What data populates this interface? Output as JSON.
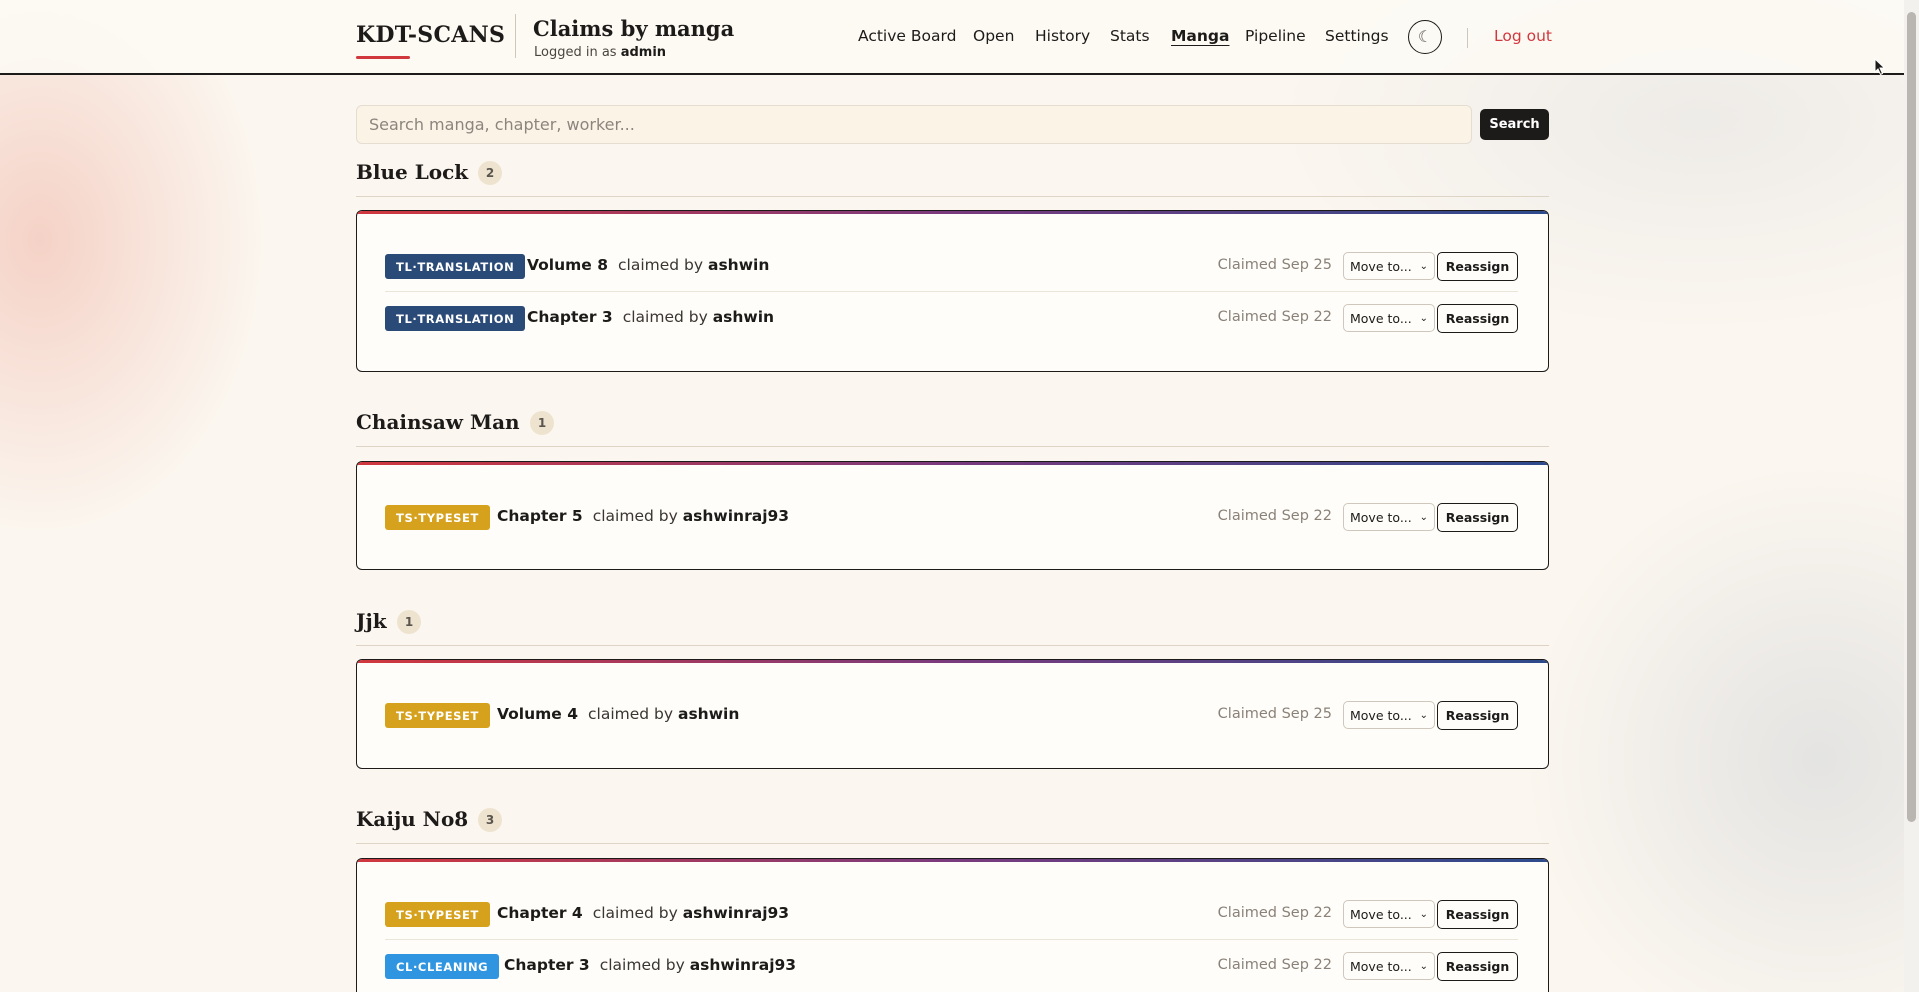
{
  "brand": "KDT-SCANS",
  "header": {
    "title": "Claims by manga",
    "logged_in_prefix": "Logged in as",
    "user": "admin"
  },
  "nav": [
    {
      "label": "Active Board",
      "active": false
    },
    {
      "label": "Open",
      "active": false
    },
    {
      "label": "History",
      "active": false
    },
    {
      "label": "Stats",
      "active": false
    },
    {
      "label": "Manga",
      "active": true
    },
    {
      "label": "Pipeline",
      "active": false
    },
    {
      "label": "Settings",
      "active": false
    }
  ],
  "theme_toggle": {
    "icon": "moon-icon",
    "glyph": "☾"
  },
  "logout_label": "Log out",
  "search": {
    "placeholder": "Search manga, chapter, worker...",
    "value": "",
    "button_label": "Search"
  },
  "labels": {
    "claimed_by": "claimed by",
    "move_to": "Move to...",
    "reassign": "Reassign"
  },
  "colors": {
    "accent_red": "#d1383e",
    "tl_translation": "#2a4a78",
    "ts_typeset": "#d6a21d",
    "cl_cleaning": "#2f95e0"
  },
  "groups": [
    {
      "title": "Blue Lock",
      "count": "2",
      "claims": [
        {
          "stage": "TL·TRANSLATION",
          "stage_key": "tl_translation",
          "chapter": "Volume 8",
          "worker": "ashwin",
          "claimed": "Claimed Sep 25"
        },
        {
          "stage": "TL·TRANSLATION",
          "stage_key": "tl_translation",
          "chapter": "Chapter 3",
          "worker": "ashwin",
          "claimed": "Claimed Sep 22"
        }
      ]
    },
    {
      "title": "Chainsaw Man",
      "count": "1",
      "claims": [
        {
          "stage": "TS·TYPESET",
          "stage_key": "ts_typeset",
          "chapter": "Chapter 5",
          "worker": "ashwinraj93",
          "claimed": "Claimed Sep 22"
        }
      ]
    },
    {
      "title": "Jjk",
      "count": "1",
      "claims": [
        {
          "stage": "TS·TYPESET",
          "stage_key": "ts_typeset",
          "chapter": "Volume 4",
          "worker": "ashwin",
          "claimed": "Claimed Sep 25"
        }
      ]
    },
    {
      "title": "Kaiju No8",
      "count": "3",
      "claims": [
        {
          "stage": "TS·TYPESET",
          "stage_key": "ts_typeset",
          "chapter": "Chapter 4",
          "worker": "ashwinraj93",
          "claimed": "Claimed Sep 22"
        },
        {
          "stage": "CL·CLEANING",
          "stage_key": "cl_cleaning",
          "chapter": "Chapter 3",
          "worker": "ashwinraj93",
          "claimed": "Claimed Sep 22"
        }
      ]
    }
  ]
}
